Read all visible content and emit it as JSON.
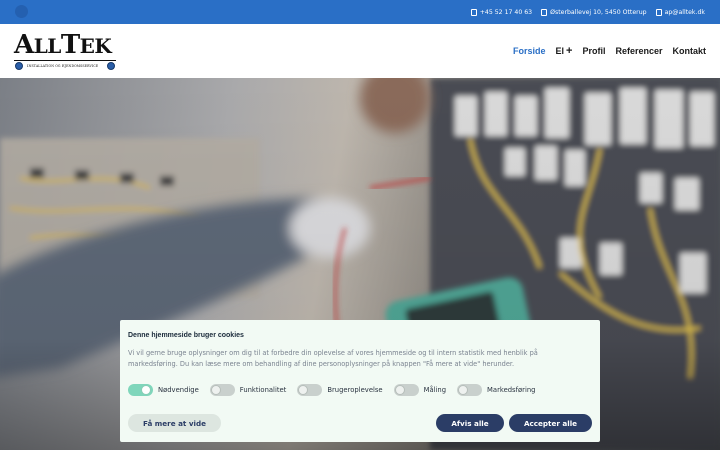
{
  "topbar": {
    "phone": "+45 52 17 40 63",
    "address": "Østerballevej 10, 5450 Otterup",
    "email": "ap@alltek.dk",
    "colors": {
      "bar": "#2a6fc6"
    }
  },
  "logo": {
    "wordmark": "AllTek",
    "tagline": "Installation og Ejendomsservice"
  },
  "nav": {
    "items": [
      {
        "label": "Forside",
        "active": true
      },
      {
        "label": "El",
        "dropdown": true
      },
      {
        "label": "Profil"
      },
      {
        "label": "Referencer"
      },
      {
        "label": "Kontakt"
      }
    ],
    "dropdown_glyph": "+",
    "active_color": "#2a6fc6"
  },
  "cookie": {
    "title": "Denne hjemmeside bruger cookies",
    "body": "Vi vil gerne bruge oplysninger om dig til at forbedre din oplevelse af vores hjemmeside og til intern statistik med henblik på markedsføring. Du kan læse mere om behandling af dine personoplysninger på knappen \"Få mere at vide\" herunder.",
    "toggles": [
      {
        "label": "Nødvendige",
        "on": true
      },
      {
        "label": "Funktionalitet",
        "on": false
      },
      {
        "label": "Brugeroplevelse",
        "on": false
      },
      {
        "label": "Måling",
        "on": false
      },
      {
        "label": "Markedsføring",
        "on": false
      }
    ],
    "more_label": "Få mere at vide",
    "deny_label": "Afvis alle",
    "accept_label": "Accepter alle",
    "colors": {
      "button": "#2b3d66",
      "toggle_on": "#7fd6bb"
    }
  }
}
